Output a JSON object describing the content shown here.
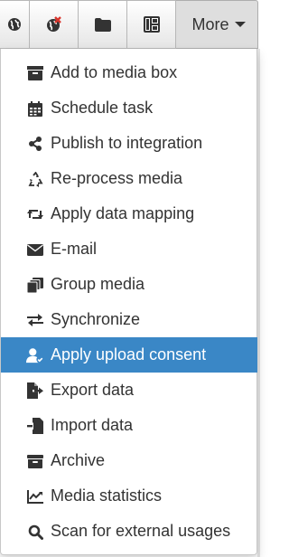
{
  "toolbar": {
    "more_label": "More"
  },
  "menu": {
    "items": [
      {
        "label": "Add to media box",
        "icon": "archive-box-icon"
      },
      {
        "label": "Schedule task",
        "icon": "calendar-icon"
      },
      {
        "label": "Publish to integration",
        "icon": "share-icon"
      },
      {
        "label": "Re-process media",
        "icon": "recycle-icon"
      },
      {
        "label": "Apply data mapping",
        "icon": "retweet-icon"
      },
      {
        "label": "E-mail",
        "icon": "envelope-icon"
      },
      {
        "label": "Group media",
        "icon": "clone-icon"
      },
      {
        "label": "Synchronize",
        "icon": "exchange-icon"
      },
      {
        "label": "Apply upload consent",
        "icon": "user-check-icon",
        "active": true
      },
      {
        "label": "Export data",
        "icon": "file-export-icon"
      },
      {
        "label": "Import data",
        "icon": "file-import-icon"
      },
      {
        "label": "Archive",
        "icon": "archive-icon"
      },
      {
        "label": "Media statistics",
        "icon": "line-chart-icon"
      },
      {
        "label": "Scan for external usages",
        "icon": "search-icon"
      }
    ]
  },
  "colors": {
    "active_bg": "#3a87c6",
    "text": "#333333"
  }
}
